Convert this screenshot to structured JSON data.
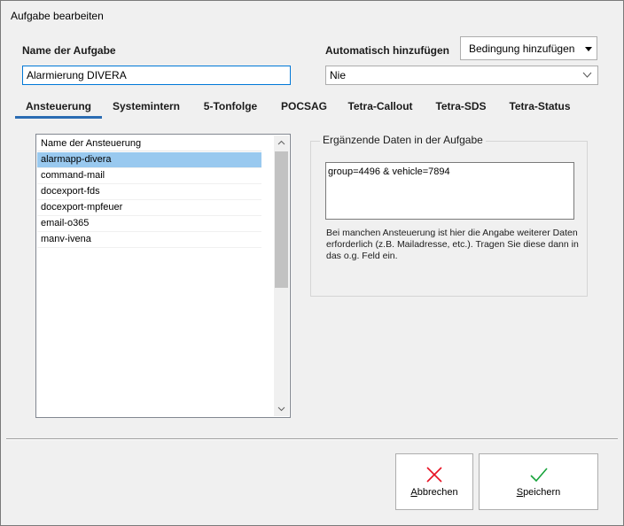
{
  "window": {
    "title": "Aufgabe bearbeiten"
  },
  "task_name": {
    "label": "Name der Aufgabe",
    "value": "Alarmierung DIVERA"
  },
  "auto_add": {
    "label": "Automatisch hinzufügen",
    "condition_button": "Bedingung hinzufügen",
    "selected_value": "Nie"
  },
  "tabs": [
    {
      "label": "Ansteuerung",
      "active": true
    },
    {
      "label": "Systemintern",
      "active": false
    },
    {
      "label": "5-Tonfolge",
      "active": false
    },
    {
      "label": "POCSAG",
      "active": false
    },
    {
      "label": "Tetra-Callout",
      "active": false
    },
    {
      "label": "Tetra-SDS",
      "active": false
    },
    {
      "label": "Tetra-Status",
      "active": false
    }
  ],
  "control_list": {
    "header": "Name der Ansteuerung",
    "items": [
      {
        "label": "alarmapp-divera",
        "selected": true
      },
      {
        "label": "command-mail",
        "selected": false
      },
      {
        "label": "docexport-fds",
        "selected": false
      },
      {
        "label": "docexport-mpfeuer",
        "selected": false
      },
      {
        "label": "email-o365",
        "selected": false
      },
      {
        "label": "manv-ivena",
        "selected": false
      }
    ]
  },
  "extra_data": {
    "group_title": "Ergänzende Daten in der Aufgabe",
    "value": "group=4496 & vehicle=7894",
    "help_text": "Bei manchen Ansteuerung ist hier die Angabe weiterer Daten erforderlich (z.B. Mailadresse, etc.). Tragen Sie diese dann in das o.g. Feld ein."
  },
  "buttons": {
    "cancel": {
      "accel": "A",
      "rest": "bbrechen"
    },
    "save": {
      "accel": "S",
      "rest": "peichern"
    }
  },
  "colors": {
    "accent": "#0078d7",
    "selection": "#99c9ef",
    "cancel_icon": "#e81123",
    "save_icon": "#16a33a",
    "tab_underline": "#2b6cb3"
  },
  "icons": {
    "cancel": "x-icon",
    "save": "check-icon",
    "combo": "chevron-down-icon",
    "dropdown": "caret-down-icon"
  }
}
